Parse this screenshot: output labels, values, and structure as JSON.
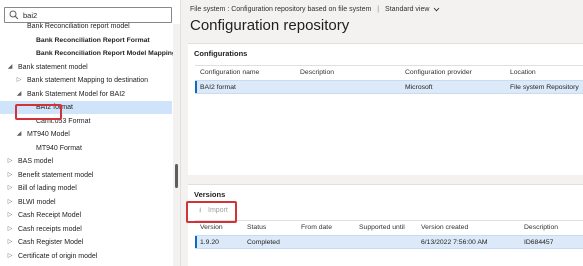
{
  "search": {
    "value": "bai2"
  },
  "tree": [
    {
      "label": "Bank Reconciliation report model",
      "indent": 1,
      "arrow": "",
      "bold": false
    },
    {
      "label": "Bank Reconciliation Report Format",
      "indent": 2,
      "arrow": "",
      "bold": true
    },
    {
      "label": "Bank Reconciliation Report Model Mapping",
      "indent": 2,
      "arrow": "",
      "bold": true
    },
    {
      "label": "Bank statement model",
      "indent": 0,
      "arrow": "expanded",
      "bold": false
    },
    {
      "label": "Bank statement Mapping to destination",
      "indent": 1,
      "arrow": "collapsed",
      "bold": false
    },
    {
      "label": "Bank Statement Model for BAI2",
      "indent": 1,
      "arrow": "expanded",
      "bold": false
    },
    {
      "label": "BAI2 format",
      "indent": 2,
      "arrow": "",
      "bold": false,
      "selected": true
    },
    {
      "label": "Camt.053 Format",
      "indent": 2,
      "arrow": "",
      "bold": false
    },
    {
      "label": "MT940 Model",
      "indent": 1,
      "arrow": "expanded",
      "bold": false
    },
    {
      "label": "MT940 Format",
      "indent": 2,
      "arrow": "",
      "bold": false
    },
    {
      "label": "BAS model",
      "indent": 0,
      "arrow": "collapsed",
      "bold": false
    },
    {
      "label": "Benefit statement model",
      "indent": 0,
      "arrow": "collapsed",
      "bold": false
    },
    {
      "label": "Bill of lading model",
      "indent": 0,
      "arrow": "collapsed",
      "bold": false
    },
    {
      "label": "BLWI model",
      "indent": 0,
      "arrow": "collapsed",
      "bold": false
    },
    {
      "label": "Cash Receipt Model",
      "indent": 0,
      "arrow": "collapsed",
      "bold": false
    },
    {
      "label": "Cash receipts model",
      "indent": 0,
      "arrow": "collapsed",
      "bold": false
    },
    {
      "label": "Cash Register Model",
      "indent": 0,
      "arrow": "collapsed",
      "bold": false
    },
    {
      "label": "Certificate of origin model",
      "indent": 0,
      "arrow": "collapsed",
      "bold": false
    }
  ],
  "header": {
    "breadcrumb": "File system : Configuration repository based on file system",
    "separator": "|",
    "view": "Standard view",
    "title": "Configuration repository"
  },
  "configurations": {
    "heading": "Configurations",
    "columns": [
      "Configuration name",
      "Description",
      "Configuration provider",
      "Location"
    ],
    "rows": [
      [
        "BAI2 format",
        "",
        "Microsoft",
        "File system Repository"
      ]
    ]
  },
  "versions": {
    "heading": "Versions",
    "import_label": "Import",
    "columns": [
      "Version",
      "Status",
      "From date",
      "Supported until",
      "Version created",
      "Description"
    ],
    "rows": [
      [
        "1.9.20",
        "Completed",
        "",
        "",
        "6/13/2022 7:56:00 AM",
        "ID684457"
      ]
    ]
  },
  "colors": {
    "selection": "#cfe4fa",
    "highlight_box": "#d13438",
    "accent": "#0f6cbd"
  }
}
